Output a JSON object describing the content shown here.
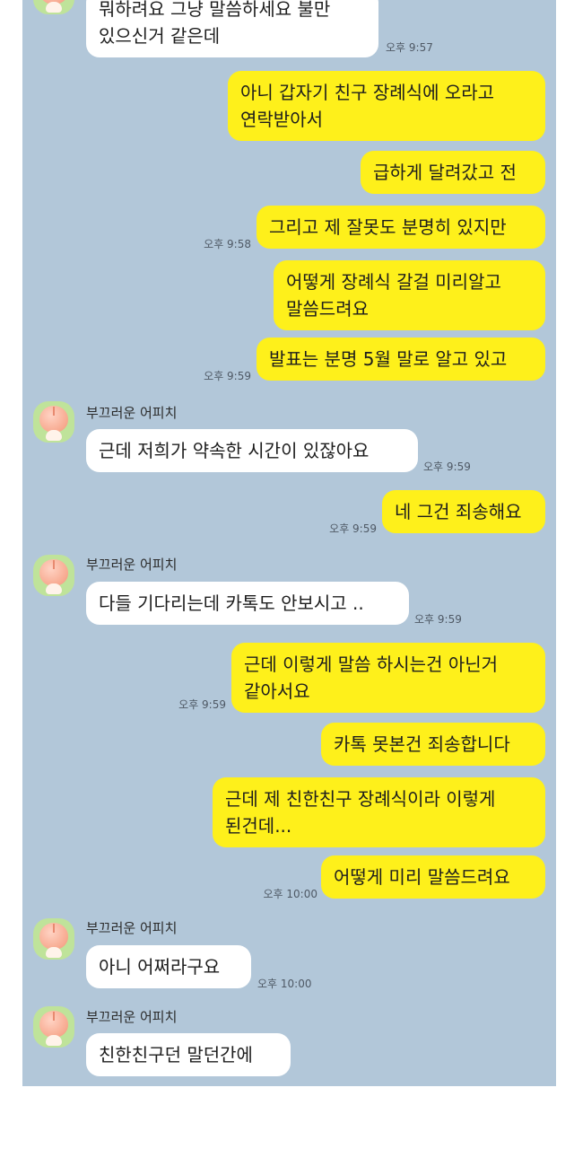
{
  "sender_name": "부끄러운 어피치",
  "messages": [
    {
      "text": "뭐하려요 그냥 말씀하세요 불만\n있으신거 같은데",
      "time": "오후 9:57"
    },
    {
      "text": "아니 갑자기 친구 장례식에 오라고\n연락받아서",
      "time": ""
    },
    {
      "text": "급하게 달려갔고 전",
      "time": ""
    },
    {
      "text": "그리고 제 잘못도 분명히 있지만",
      "time": "오후 9:58"
    },
    {
      "text": "어떻게 장례식 갈걸 미리알고\n말씀드려요",
      "time": ""
    },
    {
      "text": "발표는 분명 5월 말로 알고 있고",
      "time": "오후 9:59"
    },
    {
      "text": "근데 저희가 약속한 시간이 있잖아요",
      "time": "오후 9:59"
    },
    {
      "text": "네 그건 죄송해요",
      "time": "오후 9:59"
    },
    {
      "text": "다들 기다리는데 카톡도 안보시고 ..",
      "time": "오후 9:59"
    },
    {
      "text": "근데 이렇게 말씀 하시는건 아닌거\n같아서요",
      "time": "오후 9:59"
    },
    {
      "text": "카톡 못본건 죄송합니다",
      "time": ""
    },
    {
      "text": "근데 제 친한친구 장례식이라 이렇게\n된건데...",
      "time": ""
    },
    {
      "text": "어떻게 미리 말씀드려요",
      "time": "오후 10:00"
    },
    {
      "text": "아니 어쩌라구요",
      "time": "오후 10:00"
    },
    {
      "text": "친한친구던 말던간에",
      "time": ""
    }
  ],
  "colors": {
    "background": "#b2c7d9",
    "outgoing_bubble": "#fef01b",
    "incoming_bubble": "#ffffff",
    "avatar_background": "#bfe39a"
  },
  "icons": {
    "avatar": "apeach-profile-icon"
  }
}
